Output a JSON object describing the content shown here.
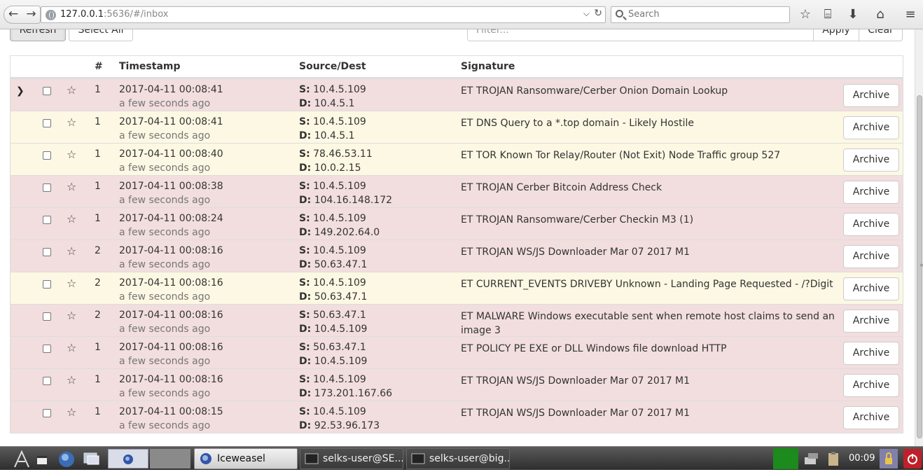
{
  "browser": {
    "url_host": "127.0.0.1",
    "url_path": ":5636/#/inbox",
    "search_placeholder": "Search"
  },
  "toolbar": {
    "refresh_label": "Refresh",
    "select_all_label": "Select All",
    "filter_placeholder": "Filter...",
    "apply_label": "Apply",
    "clear_label": "Clear"
  },
  "table": {
    "headers": {
      "count": "#",
      "timestamp": "Timestamp",
      "source_dest": "Source/Dest",
      "signature": "Signature"
    },
    "src_label": "S:",
    "dst_label": "D:",
    "archive_label": "Archive",
    "rows": [
      {
        "count": "1",
        "timestamp": "2017-04-11 00:08:41",
        "ago": "a few seconds ago",
        "src": "10.4.5.109",
        "dst": "10.4.5.1",
        "signature": "ET TROJAN Ransomware/Cerber Onion Domain Lookup",
        "severity": "high"
      },
      {
        "count": "1",
        "timestamp": "2017-04-11 00:08:41",
        "ago": "a few seconds ago",
        "src": "10.4.5.109",
        "dst": "10.4.5.1",
        "signature": "ET DNS Query to a *.top domain - Likely Hostile",
        "severity": "medium"
      },
      {
        "count": "1",
        "timestamp": "2017-04-11 00:08:40",
        "ago": "a few seconds ago",
        "src": "78.46.53.11",
        "dst": "10.0.2.15",
        "signature": "ET TOR Known Tor Relay/Router (Not Exit) Node Traffic group 527",
        "severity": "medium"
      },
      {
        "count": "1",
        "timestamp": "2017-04-11 00:08:38",
        "ago": "a few seconds ago",
        "src": "10.4.5.109",
        "dst": "104.16.148.172",
        "signature": "ET TROJAN Cerber Bitcoin Address Check",
        "severity": "high"
      },
      {
        "count": "1",
        "timestamp": "2017-04-11 00:08:24",
        "ago": "a few seconds ago",
        "src": "10.4.5.109",
        "dst": "149.202.64.0",
        "signature": "ET TROJAN Ransomware/Cerber Checkin M3 (1)",
        "severity": "high"
      },
      {
        "count": "2",
        "timestamp": "2017-04-11 00:08:16",
        "ago": "a few seconds ago",
        "src": "10.4.5.109",
        "dst": "50.63.47.1",
        "signature": "ET TROJAN WS/JS Downloader Mar 07 2017 M1",
        "severity": "high"
      },
      {
        "count": "2",
        "timestamp": "2017-04-11 00:08:16",
        "ago": "a few seconds ago",
        "src": "10.4.5.109",
        "dst": "50.63.47.1",
        "signature": "ET CURRENT_EVENTS DRIVEBY Unknown - Landing Page Requested - /?Digit",
        "severity": "medium"
      },
      {
        "count": "2",
        "timestamp": "2017-04-11 00:08:16",
        "ago": "a few seconds ago",
        "src": "50.63.47.1",
        "dst": "10.4.5.109",
        "signature": "ET MALWARE Windows executable sent when remote host claims to send an image 3",
        "severity": "high"
      },
      {
        "count": "1",
        "timestamp": "2017-04-11 00:08:16",
        "ago": "a few seconds ago",
        "src": "50.63.47.1",
        "dst": "10.4.5.109",
        "signature": "ET POLICY PE EXE or DLL Windows file download HTTP",
        "severity": "high"
      },
      {
        "count": "1",
        "timestamp": "2017-04-11 00:08:16",
        "ago": "a few seconds ago",
        "src": "10.4.5.109",
        "dst": "173.201.167.66",
        "signature": "ET TROJAN WS/JS Downloader Mar 07 2017 M1",
        "severity": "high"
      },
      {
        "count": "1",
        "timestamp": "2017-04-11 00:08:15",
        "ago": "a few seconds ago",
        "src": "10.4.5.109",
        "dst": "92.53.96.173",
        "signature": "ET TROJAN WS/JS Downloader Mar 07 2017 M1",
        "severity": "high"
      }
    ]
  },
  "taskbar": {
    "tasks": [
      "Iceweasel",
      "selks-user@SE...",
      "selks-user@big..."
    ],
    "clock": "00:09"
  }
}
